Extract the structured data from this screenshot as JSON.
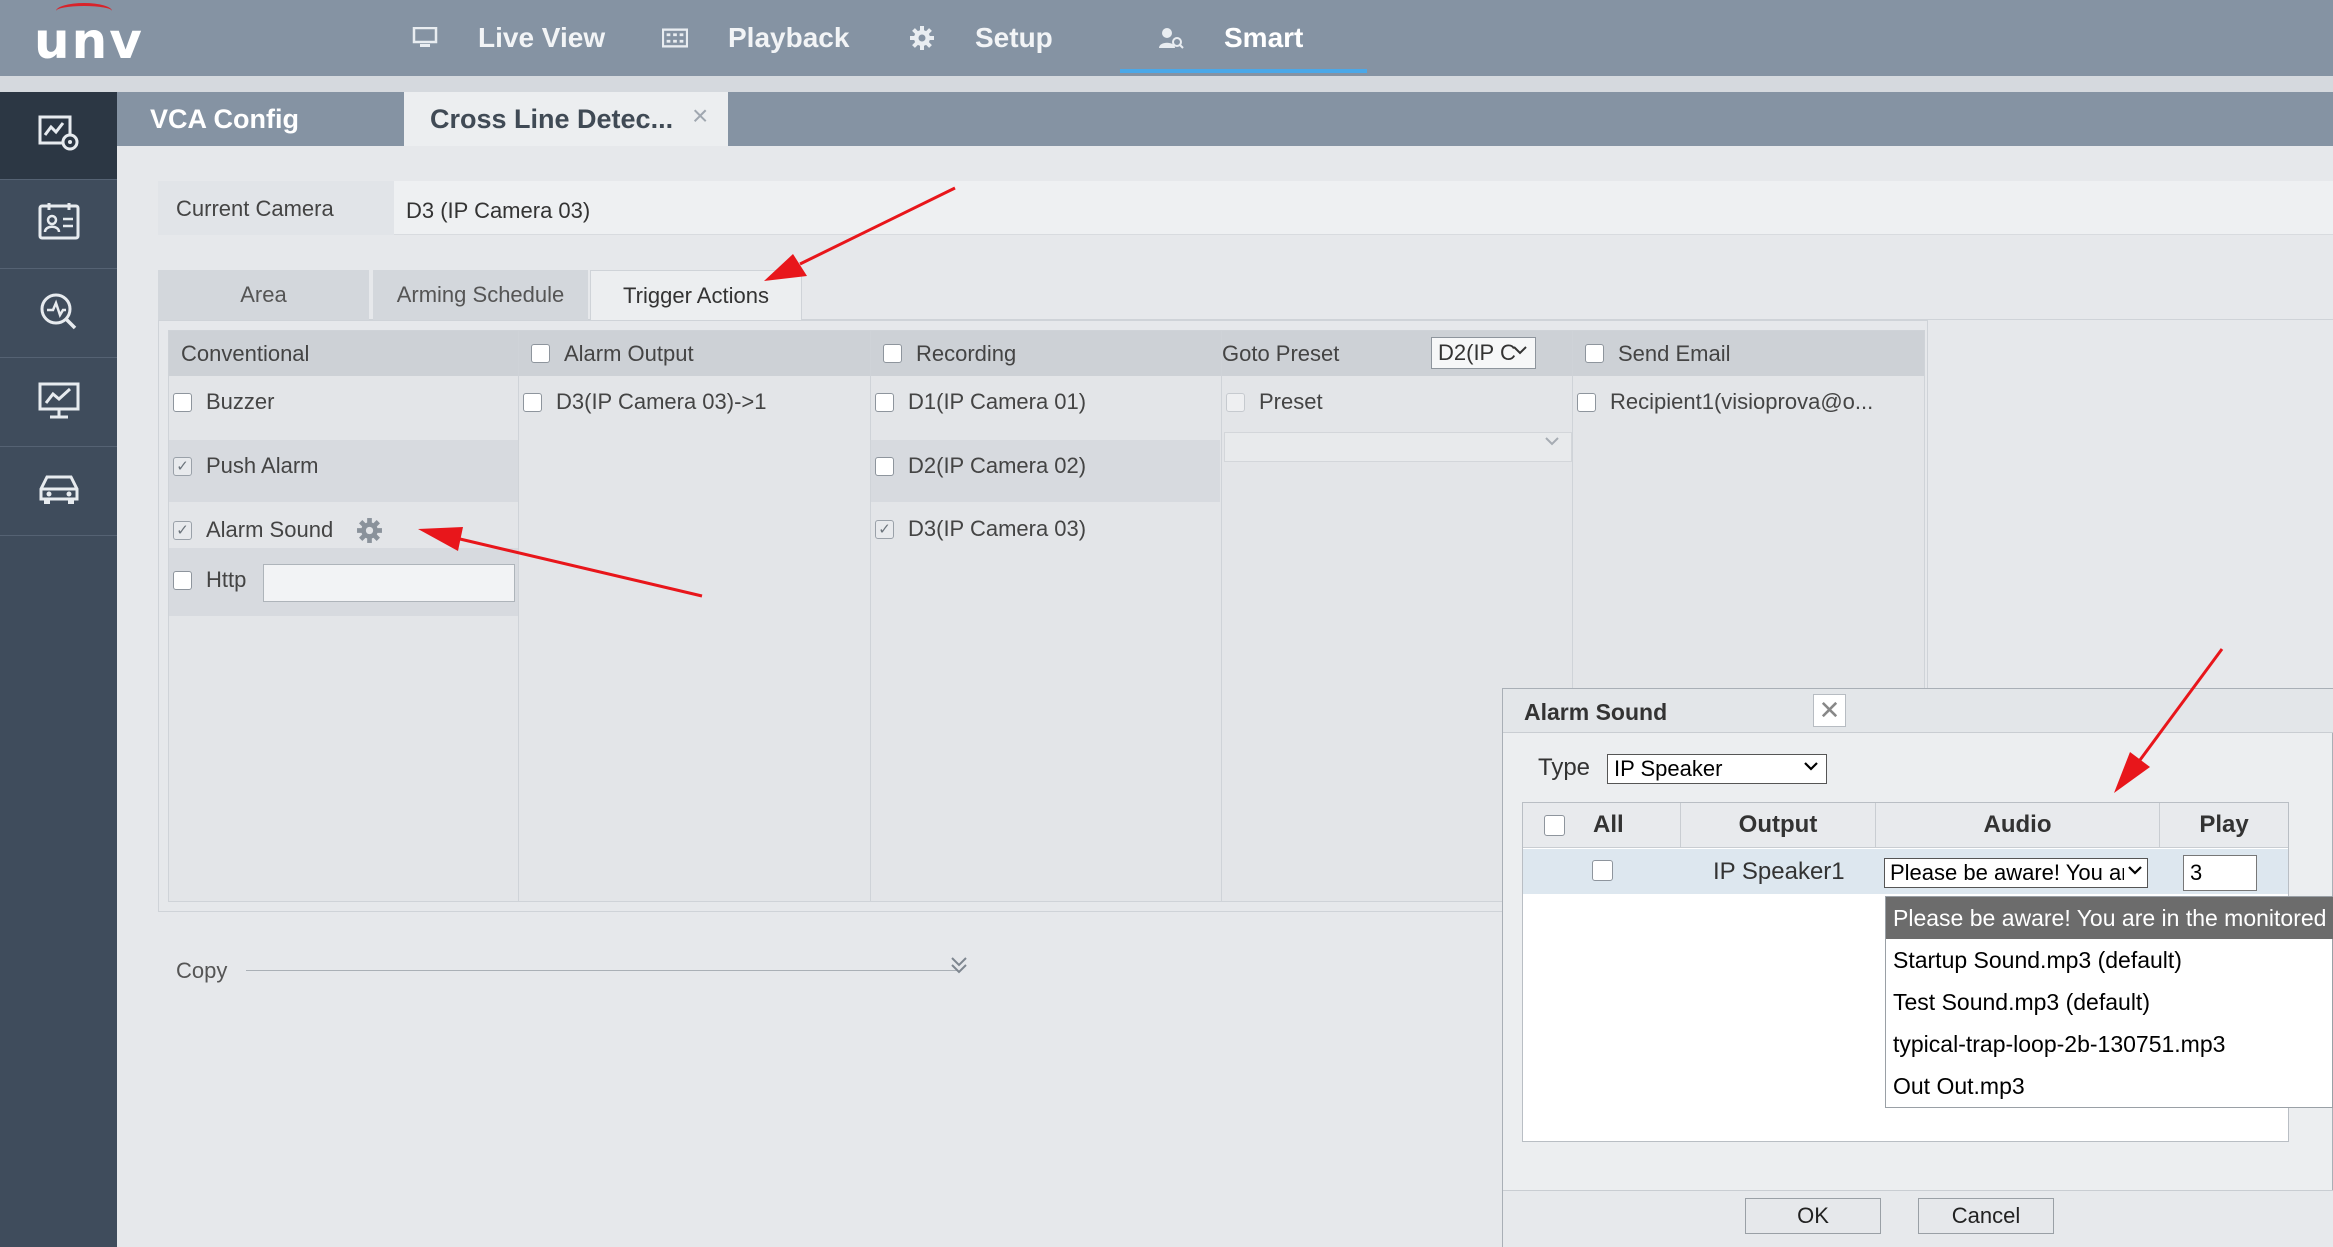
{
  "topnav": {
    "logo": "unv",
    "items": [
      {
        "label": "Live View",
        "icon": "monitor-icon"
      },
      {
        "label": "Playback",
        "icon": "film-icon"
      },
      {
        "label": "Setup",
        "icon": "gear-icon"
      },
      {
        "label": "Smart",
        "icon": "person-search-icon",
        "active": true
      }
    ]
  },
  "sidebar": {
    "items": [
      {
        "icon": "vca-config-icon",
        "active": true
      },
      {
        "icon": "face-list-icon"
      },
      {
        "icon": "search-analytics-icon"
      },
      {
        "icon": "chart-monitor-icon"
      },
      {
        "icon": "vehicle-icon"
      }
    ]
  },
  "tabs": {
    "vca": "VCA Config",
    "cross": "Cross Line Detec...",
    "close_glyph": "×"
  },
  "camera": {
    "label": "Current Camera",
    "value": "D3 (IP Camera 03)"
  },
  "subtabs": [
    "Area",
    "Arming Schedule",
    "Trigger Actions"
  ],
  "active_subtab": "Trigger Actions",
  "trigger": {
    "conventional": {
      "header": "Conventional",
      "buzzer": "Buzzer",
      "push_alarm": "Push Alarm",
      "alarm_sound": "Alarm Sound",
      "http": "Http"
    },
    "alarm_output": {
      "header": "Alarm Output",
      "items": [
        "D3(IP Camera 03)->1"
      ]
    },
    "recording": {
      "header": "Recording",
      "items": [
        "D1(IP Camera 01)",
        "D2(IP Camera 02)",
        "D3(IP Camera 03)"
      ]
    },
    "goto_preset": {
      "header": "Goto Preset",
      "select": "D2(IP C",
      "preset": "Preset"
    },
    "send_email": {
      "header": "Send Email",
      "items": [
        "Recipient1(visioprova@o..."
      ]
    }
  },
  "copy": {
    "label": "Copy"
  },
  "dialog": {
    "title": "Alarm Sound",
    "close_glyph": "✕",
    "type_label": "Type",
    "type_value": "IP Speaker",
    "headers": {
      "all": "All",
      "output": "Output",
      "audio": "Audio",
      "play": "Play"
    },
    "row": {
      "output": "IP Speaker1",
      "audio": "Please be aware! You are",
      "play": "3"
    },
    "dropdown_options": [
      "Please be aware! You are in the monitored",
      "Startup Sound.mp3 (default)",
      "Test Sound.mp3 (default)",
      "typical-trap-loop-2b-130751.mp3",
      "Out Out.mp3"
    ],
    "ok": "OK",
    "cancel": "Cancel"
  },
  "colors": {
    "topbar": "#8593a3",
    "sidebar": "#3f4c5c",
    "accent_underline": "#4aa8e8",
    "annotation_arrow": "#e8161b"
  }
}
